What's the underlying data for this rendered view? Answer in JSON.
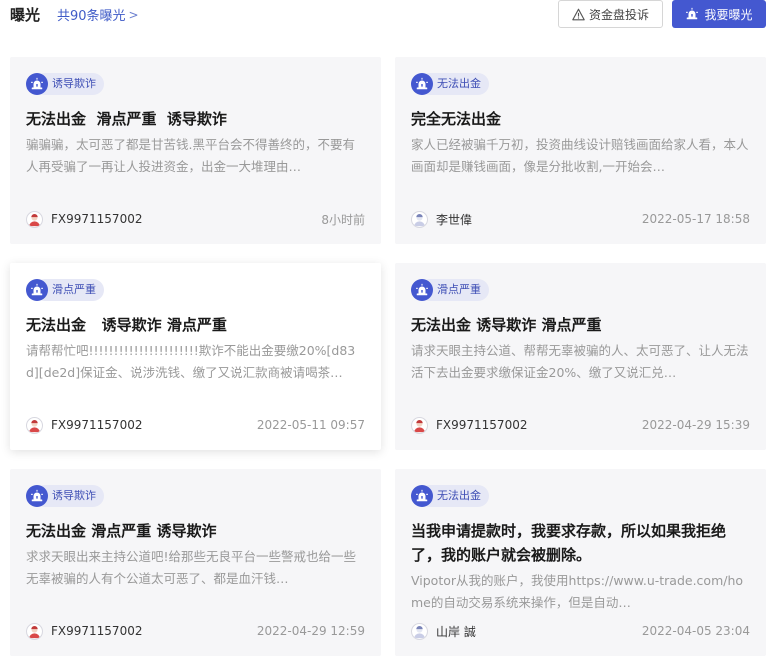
{
  "header": {
    "title": "曝光",
    "count_link": "共90条曝光",
    "complaint_button": "资金盘投诉",
    "expose_button": "我要曝光"
  },
  "colors": {
    "accent": "#4458d0",
    "tag_bg": "#e6e8f6",
    "card_bg": "#f6f6f8"
  },
  "cards": [
    {
      "tag": "诱导欺诈",
      "title": "无法出金  滑点严重  诱导欺诈",
      "desc": "骗骗骗，太可恶了都是甘苦钱.黑平台会不得善终的，不要有人再受骗了一再让人投进资金，出金一大堆理由…",
      "author": "FX9971157002",
      "avatar_icon": "user-red-avatar-icon",
      "time": "8小时前"
    },
    {
      "tag": "无法出金",
      "title": "完全无法出金",
      "desc": "家人已经被骗千万初，投资曲线设计赔钱画面给家人看，本人画面却是赚钱画面，像是分批收割,一开始会…",
      "author": "李世偉",
      "avatar_icon": "user-blue-avatar-icon",
      "time": "2022-05-17 18:58"
    },
    {
      "tag": "滑点严重",
      "title": "无法出金   诱导欺诈 滑点严重",
      "desc": "请帮帮忙吧!!!!!!!!!!!!!!!!!!!!!!欺诈不能出金要缴20%[d83d][de2d]保证金、说涉洗钱、缴了又说汇款商被请喝茶…",
      "author": "FX9971157002",
      "avatar_icon": "user-red-avatar-icon",
      "time": "2022-05-11 09:57"
    },
    {
      "tag": "滑点严重",
      "title": "无法出金 诱导欺诈 滑点严重",
      "desc": "请求天眼主持公道、帮帮无辜被骗的人、太可恶了、让人无法活下去出金要求缴保证金20%、缴了又说汇兑…",
      "author": "FX9971157002",
      "avatar_icon": "user-red-avatar-icon",
      "time": "2022-04-29 15:39"
    },
    {
      "tag": "诱导欺诈",
      "title": "无法出金 滑点严重 诱导欺诈",
      "desc": "求求天眼出来主持公道吧!给那些无良平台一些警戒也给一些无辜被骗的人有个公道太可恶了、都是血汗钱…",
      "author": "FX9971157002",
      "avatar_icon": "user-red-avatar-icon",
      "time": "2022-04-29 12:59"
    },
    {
      "tag": "无法出金",
      "title": "当我申请提款时，我要求存款，所以如果我拒绝了，我的账户就会被删除。",
      "desc": "Vipotor从我的账户，我使用https://www.u-trade.com/home的自动交易系统来操作，但是自动…",
      "author": "山岸 誠",
      "avatar_icon": "user-blue-avatar-icon",
      "time": "2022-04-05 23:04"
    }
  ]
}
